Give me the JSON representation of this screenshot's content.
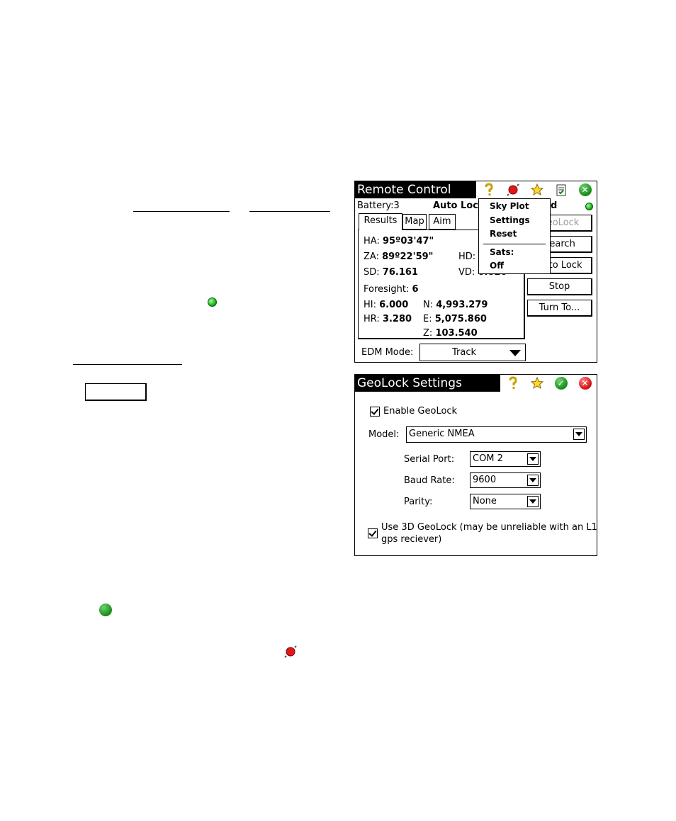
{
  "remote_control": {
    "title": "Remote Control",
    "battery": "Battery:3",
    "status": "Auto Lock",
    "status_tail": "d",
    "tabs": [
      "Results",
      "Map",
      "Aim"
    ],
    "fields": {
      "ha_label": "HA:",
      "ha": "95º03'47\"",
      "za_label": "ZA:",
      "za": "89º22'59\"",
      "hd_label": "HD:",
      "sd_label": "SD:",
      "sd": "76.161",
      "vd_label": "VD:",
      "vd": "0.820",
      "foresight_label": "Foresight:",
      "foresight": "6",
      "hi_label": "HI:",
      "hi": "6.000",
      "hr_label": "HR:",
      "hr": "3.280",
      "n_label": "N:",
      "n": "4,993.279",
      "e_label": "E:",
      "e": "5,075.860",
      "z_label": "Z:",
      "z": "103.540"
    },
    "buttons": [
      "GeoLock",
      "Search",
      "Auto Lock",
      "Stop",
      "Turn To..."
    ],
    "edm_label": "EDM Mode:",
    "edm_value": "Track",
    "menu": {
      "items": [
        "Sky Plot",
        "Settings",
        "Reset"
      ],
      "sats_label": "Sats:",
      "sats_value": "Off"
    }
  },
  "geolock_settings": {
    "title": "GeoLock Settings",
    "enable_label": "Enable GeoLock",
    "model_label": "Model:",
    "model_value": "Generic NMEA",
    "serial_port_label": "Serial Port:",
    "serial_port_value": "COM 2",
    "baud_label": "Baud Rate:",
    "baud_value": "9600",
    "parity_label": "Parity:",
    "parity_value": "None",
    "use3d_line1": "Use 3D GeoLock (may be unreliable with an L1",
    "use3d_line2": "gps reciever)"
  },
  "colors": {
    "titlebar": "#000000",
    "ok_green": "#178a17",
    "cancel_red": "#d01010"
  }
}
